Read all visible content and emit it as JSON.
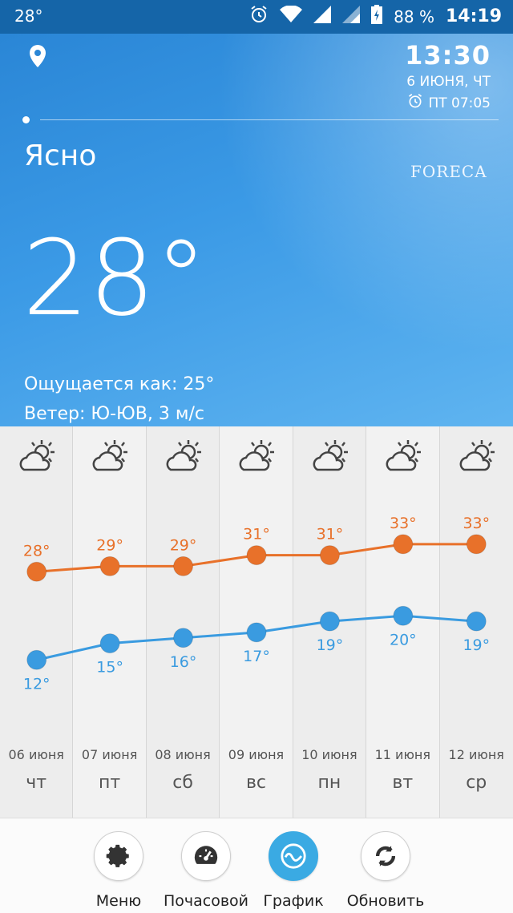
{
  "status": {
    "temp": "28°",
    "battery": "88 %",
    "time": "14:19"
  },
  "header": {
    "clock_time": "13:30",
    "date": "6 ИЮНЯ, ЧТ",
    "alarm": "ПТ 07:05",
    "brand": "FORECA"
  },
  "current": {
    "condition": "Ясно",
    "temperature": "28°",
    "feels_like": "Ощущается как: 25°",
    "wind": "Ветер: Ю-ЮВ, 3 м/с"
  },
  "forecast": [
    {
      "date": "06 июня",
      "dow": "чт",
      "icon": "partly-cloudy-icon"
    },
    {
      "date": "07 июня",
      "dow": "пт",
      "icon": "partly-cloudy-icon"
    },
    {
      "date": "08 июня",
      "dow": "сб",
      "icon": "partly-cloudy-icon"
    },
    {
      "date": "09 июня",
      "dow": "вс",
      "icon": "partly-cloudy-icon"
    },
    {
      "date": "10 июня",
      "dow": "пн",
      "icon": "partly-cloudy-icon"
    },
    {
      "date": "11 июня",
      "dow": "вт",
      "icon": "partly-cloudy-icon"
    },
    {
      "date": "12 июня",
      "dow": "ср",
      "icon": "partly-cloudy-icon"
    }
  ],
  "chart_data": {
    "type": "line",
    "categories": [
      "06 июня",
      "07 июня",
      "08 июня",
      "09 июня",
      "10 июня",
      "11 июня",
      "12 июня"
    ],
    "series": [
      {
        "values": [
          28,
          29,
          29,
          31,
          31,
          33,
          33
        ],
        "color": "#e8712a",
        "labels": [
          "28°",
          "29°",
          "29°",
          "31°",
          "31°",
          "33°",
          "33°"
        ]
      },
      {
        "values": [
          12,
          15,
          16,
          17,
          19,
          20,
          19
        ],
        "color": "#3a9be0",
        "labels": [
          "12°",
          "15°",
          "16°",
          "17°",
          "19°",
          "20°",
          "19°"
        ]
      }
    ]
  },
  "nav": {
    "menu": "Меню",
    "hourly": "Почасовой",
    "graph": "График",
    "refresh": "Обновить"
  },
  "colors": {
    "accent": "#3aaae3",
    "high": "#e8712a",
    "low": "#3a9be0"
  }
}
